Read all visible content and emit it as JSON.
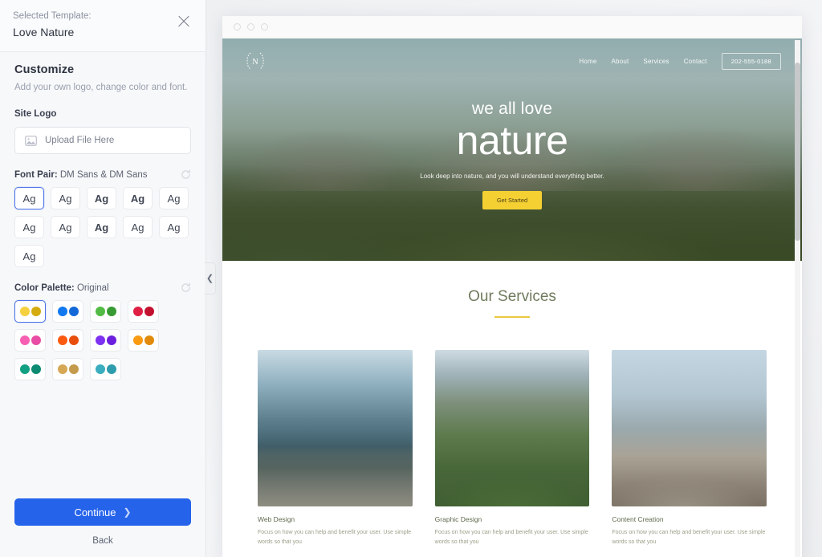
{
  "panel": {
    "selected_template_label": "Selected Template:",
    "selected_template_name": "Love Nature",
    "close_icon": "close-icon",
    "customize_title": "Customize",
    "customize_subtitle": "Add your own logo, change color and font.",
    "site_logo_label": "Site Logo",
    "upload": {
      "icon": "image-icon",
      "text": "Upload File Here"
    },
    "font_pair": {
      "label": "Font Pair:",
      "value": "DM Sans & DM Sans",
      "refresh_icon": "refresh-icon",
      "chips": [
        {
          "text": "Ag",
          "weight": "400",
          "style": "normal",
          "selected": true
        },
        {
          "text": "Ag",
          "weight": "400",
          "style": "normal",
          "selected": false
        },
        {
          "text": "Ag",
          "weight": "700",
          "style": "normal",
          "selected": false
        },
        {
          "text": "Ag",
          "weight": "700",
          "style": "normal",
          "selected": false
        },
        {
          "text": "Ag",
          "weight": "400",
          "style": "normal",
          "selected": false
        },
        {
          "text": "Ag",
          "weight": "400",
          "style": "normal",
          "selected": false
        },
        {
          "text": "Ag",
          "weight": "400",
          "style": "normal",
          "selected": false
        },
        {
          "text": "Ag",
          "weight": "700",
          "style": "normal",
          "selected": false
        },
        {
          "text": "Ag",
          "weight": "400",
          "style": "normal",
          "selected": false
        },
        {
          "text": "Ag",
          "weight": "400",
          "style": "normal",
          "selected": false
        },
        {
          "text": "Ag",
          "weight": "400",
          "style": "normal",
          "selected": false
        }
      ]
    },
    "color_palette": {
      "label": "Color Palette:",
      "value": "Original",
      "refresh_icon": "refresh-icon",
      "swatches": [
        {
          "name": "original",
          "colors": [
            "#f5d13f",
            "#d4ac10"
          ],
          "selected": true
        },
        {
          "name": "blue",
          "colors": [
            "#1178ef",
            "#1368d8"
          ],
          "selected": false
        },
        {
          "name": "green",
          "colors": [
            "#52bb45",
            "#389a33"
          ],
          "selected": false
        },
        {
          "name": "red",
          "colors": [
            "#df1f44",
            "#c2102f"
          ],
          "selected": false
        },
        {
          "name": "pink",
          "colors": [
            "#f75fb2",
            "#e94ca4"
          ],
          "selected": false
        },
        {
          "name": "orange",
          "colors": [
            "#fb5a10",
            "#e84e0c"
          ],
          "selected": false
        },
        {
          "name": "purple",
          "colors": [
            "#7e31f0",
            "#6c1fdd"
          ],
          "selected": false
        },
        {
          "name": "amber",
          "colors": [
            "#f99a10",
            "#e28a0b"
          ],
          "selected": false
        },
        {
          "name": "teal",
          "colors": [
            "#12a083",
            "#0c8b72"
          ],
          "selected": false
        },
        {
          "name": "gold",
          "colors": [
            "#d6a855",
            "#c49a4c"
          ],
          "selected": false
        },
        {
          "name": "cyan",
          "colors": [
            "#3aadbe",
            "#2e9cad"
          ],
          "selected": false
        }
      ]
    },
    "continue_label": "Continue",
    "continue_chevron": "chevron-right-icon",
    "back_label": "Back"
  },
  "collapse_handle": {
    "icon": "chevron-left-icon"
  },
  "preview": {
    "window_dots": 3,
    "site": {
      "logo_letter": "N",
      "nav_links": [
        "Home",
        "About",
        "Services",
        "Contact"
      ],
      "phone": "202-555-0188",
      "hero": {
        "eyebrow": "we all love",
        "headline": "nature",
        "subtext": "Look deep into nature, and you will understand everything better.",
        "cta": "Get Started"
      },
      "services": {
        "title": "Our Services",
        "cards": [
          {
            "title": "Web Design",
            "desc": "Focus on how you can help and benefit your user. Use simple words so that you"
          },
          {
            "title": "Graphic Design",
            "desc": "Focus on how you can help and benefit your user. Use simple words so that you"
          },
          {
            "title": "Content Creation",
            "desc": "Focus on how you can help and benefit your user. Use simple words so that you"
          }
        ]
      }
    }
  }
}
